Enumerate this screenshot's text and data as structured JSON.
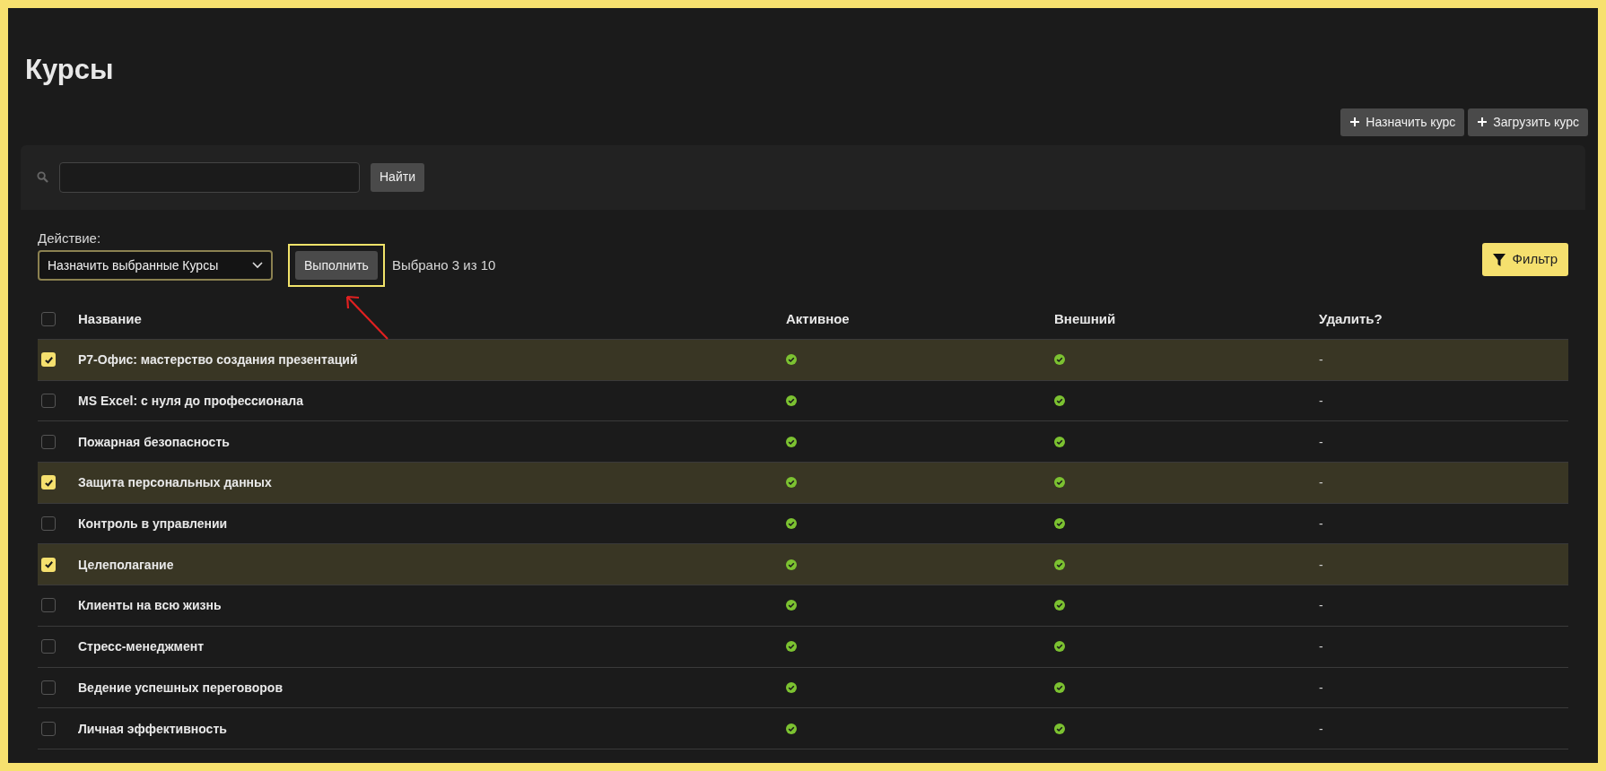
{
  "page": {
    "title": "Курсы"
  },
  "actions": [
    {
      "label": "Назначить курс"
    },
    {
      "label": "Загрузить курс"
    }
  ],
  "search": {
    "button": "Найти"
  },
  "bulk": {
    "label": "Действие:",
    "value": "Назначить выбранные Курсы",
    "run": "Выполнить",
    "highlighted": true,
    "count": "Выбрано 3 из 10"
  },
  "filter": {
    "label": "Фильтр"
  },
  "table": {
    "select_all": {
      "checked": false
    },
    "columns": [
      "Название",
      "Активное",
      "Внешний",
      "Удалить?"
    ],
    "rows": [
      {
        "name": "Р7-Офис: мастерство создания презентаций",
        "selected": true,
        "active": true,
        "external": true,
        "delete": "-"
      },
      {
        "name": "MS Excel: с нуля до профессионала",
        "selected": false,
        "active": true,
        "external": true,
        "delete": "-"
      },
      {
        "name": "Пожарная безопасность",
        "selected": false,
        "active": true,
        "external": true,
        "delete": "-"
      },
      {
        "name": "Защита персональных данных",
        "selected": true,
        "active": true,
        "external": true,
        "delete": "-"
      },
      {
        "name": "Контроль в управлении",
        "selected": false,
        "active": true,
        "external": true,
        "delete": "-"
      },
      {
        "name": "Целеполагание",
        "selected": true,
        "active": true,
        "external": true,
        "delete": "-"
      },
      {
        "name": "Клиенты на всю жизнь",
        "selected": false,
        "active": true,
        "external": true,
        "delete": "-"
      },
      {
        "name": "Стресс-менеджмент",
        "selected": false,
        "active": true,
        "external": true,
        "delete": "-"
      },
      {
        "name": "Ведение успешных переговоров",
        "selected": false,
        "active": true,
        "external": true,
        "delete": "-"
      },
      {
        "name": "Личная эффективность",
        "selected": false,
        "active": true,
        "external": true,
        "delete": "-"
      }
    ]
  }
}
